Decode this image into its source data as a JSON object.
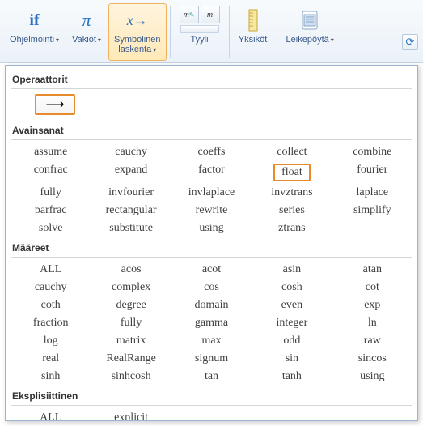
{
  "ribbon": {
    "ohjelmointi": {
      "label": "Ohjelmointi",
      "icon_text": "if"
    },
    "vakiot": {
      "label": "Vakiot",
      "icon_text": "π"
    },
    "symbolinen": {
      "label1": "Symbolinen",
      "label2": "laskenta",
      "icon_text": "x→"
    },
    "tyyli": {
      "label": "Tyyli"
    },
    "yksikot": {
      "label": "Yksiköt"
    },
    "leikepoyta": {
      "label": "Leikepöytä"
    }
  },
  "panel": {
    "sections": {
      "operaattorit": {
        "title": "Operaattorit",
        "arrow": "⟶"
      },
      "avainsanat": {
        "title": "Avainsanat",
        "rows": [
          [
            "assume",
            "cauchy",
            "coeffs",
            "collect",
            "combine"
          ],
          [
            "confrac",
            "expand",
            "factor",
            "float",
            "fourier"
          ],
          [
            "fully",
            "invfourier",
            "invlaplace",
            "invztrans",
            "laplace"
          ],
          [
            "parfrac",
            "rectangular",
            "rewrite",
            "series",
            "simplify"
          ],
          [
            "solve",
            "substitute",
            "using",
            "ztrans",
            ""
          ]
        ],
        "highlight": "float"
      },
      "maareet": {
        "title": "Määreet",
        "rows": [
          [
            "ALL",
            "acos",
            "acot",
            "asin",
            "atan"
          ],
          [
            "cauchy",
            "complex",
            "cos",
            "cosh",
            "cot"
          ],
          [
            "coth",
            "degree",
            "domain",
            "even",
            "exp"
          ],
          [
            "fraction",
            "fully",
            "gamma",
            "integer",
            "ln"
          ],
          [
            "log",
            "matrix",
            "max",
            "odd",
            "raw"
          ],
          [
            "real",
            "RealRange",
            "signum",
            "sin",
            "sincos"
          ],
          [
            "sinh",
            "sinhcosh",
            "tan",
            "tanh",
            "using"
          ]
        ]
      },
      "eksplisiittinen": {
        "title": "Eksplisiittinen",
        "rows": [
          [
            "ALL",
            "explicit",
            "",
            "",
            ""
          ]
        ]
      }
    }
  }
}
